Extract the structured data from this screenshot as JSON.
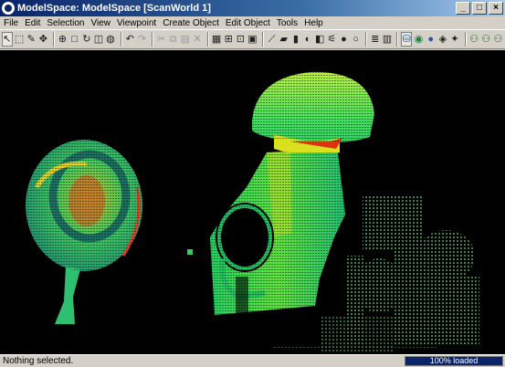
{
  "window": {
    "title": "ModelSpace: ModelSpace [ScanWorld 1]",
    "icon": "app-icon",
    "controls": [
      "minimize-icon",
      "maximize-icon",
      "close-icon"
    ]
  },
  "menu": [
    "File",
    "Edit",
    "Selection",
    "View",
    "Viewpoint",
    "Create Object",
    "Edit Object",
    "Tools",
    "Help"
  ],
  "toolbar": {
    "groups": [
      [
        "pointer-select-icon",
        "fence-select-icon",
        "pencil-icon",
        "move-icon"
      ],
      [
        "zoom-extents-icon",
        "square-icon",
        "rotate-icon",
        "cube-icon",
        "sphere-icon"
      ],
      [
        "undo-icon",
        "redo-icon"
      ],
      [
        "cut-icon",
        "copy-icon",
        "paste-icon",
        "delete-icon"
      ],
      [
        "grid-icon",
        "snap-icon",
        "lock-icon",
        "select-all-icon"
      ],
      [
        "measure-icon",
        "fit-plane-icon",
        "fit-cylinder-icon",
        "fit-sphere-icon",
        "fit-box-icon",
        "brush-icon",
        "cone-icon",
        "circle-icon"
      ],
      [
        "layers-icon",
        "object-list-icon"
      ],
      [
        "camera-icon",
        "visibility-icon",
        "color-map-icon",
        "texture-icon",
        "lighting-icon"
      ],
      [
        "scan-icon",
        "scan-settings-icon",
        "scan-target-icon"
      ]
    ],
    "pressed": [
      "pointer-select-icon",
      "camera-icon"
    ]
  },
  "statusbar": {
    "message": "Nothing selected.",
    "progress_label": "100% loaded",
    "progress": 1.0
  }
}
